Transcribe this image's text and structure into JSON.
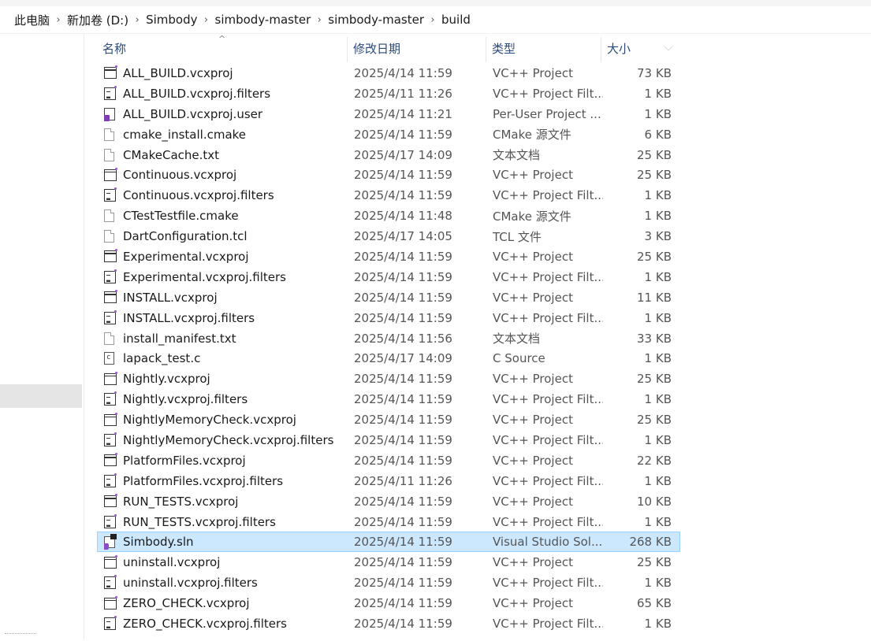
{
  "breadcrumb": [
    "此电脑",
    "新加卷 (D:)",
    "Simbody",
    "simbody-master",
    "simbody-master",
    "build"
  ],
  "columns": {
    "name": "名称",
    "date": "修改日期",
    "type": "类型",
    "size": "大小"
  },
  "files": [
    {
      "name": "ALL_BUILD.vcxproj",
      "date": "2025/4/14 11:59",
      "type": "VC++ Project",
      "size": "73 KB",
      "icon": "vcxproj-icon"
    },
    {
      "name": "ALL_BUILD.vcxproj.filters",
      "date": "2025/4/11 11:26",
      "type": "VC++ Project Filt...",
      "size": "1 KB",
      "icon": "filters-icon"
    },
    {
      "name": "ALL_BUILD.vcxproj.user",
      "date": "2025/4/14 11:21",
      "type": "Per-User Project ...",
      "size": "1 KB",
      "icon": "user-project-icon"
    },
    {
      "name": "cmake_install.cmake",
      "date": "2025/4/14 11:59",
      "type": "CMake 源文件",
      "size": "6 KB",
      "icon": "document-icon"
    },
    {
      "name": "CMakeCache.txt",
      "date": "2025/4/17 14:09",
      "type": "文本文档",
      "size": "25 KB",
      "icon": "document-icon"
    },
    {
      "name": "Continuous.vcxproj",
      "date": "2025/4/14 11:59",
      "type": "VC++ Project",
      "size": "25 KB",
      "icon": "vcxproj-icon"
    },
    {
      "name": "Continuous.vcxproj.filters",
      "date": "2025/4/14 11:59",
      "type": "VC++ Project Filt...",
      "size": "1 KB",
      "icon": "filters-icon"
    },
    {
      "name": "CTestTestfile.cmake",
      "date": "2025/4/14 11:48",
      "type": "CMake 源文件",
      "size": "1 KB",
      "icon": "document-icon"
    },
    {
      "name": "DartConfiguration.tcl",
      "date": "2025/4/17 14:05",
      "type": "TCL 文件",
      "size": "3 KB",
      "icon": "document-icon"
    },
    {
      "name": "Experimental.vcxproj",
      "date": "2025/4/14 11:59",
      "type": "VC++ Project",
      "size": "25 KB",
      "icon": "vcxproj-icon"
    },
    {
      "name": "Experimental.vcxproj.filters",
      "date": "2025/4/14 11:59",
      "type": "VC++ Project Filt...",
      "size": "1 KB",
      "icon": "filters-icon"
    },
    {
      "name": "INSTALL.vcxproj",
      "date": "2025/4/14 11:59",
      "type": "VC++ Project",
      "size": "11 KB",
      "icon": "vcxproj-icon"
    },
    {
      "name": "INSTALL.vcxproj.filters",
      "date": "2025/4/14 11:59",
      "type": "VC++ Project Filt...",
      "size": "1 KB",
      "icon": "filters-icon"
    },
    {
      "name": "install_manifest.txt",
      "date": "2025/4/14 11:56",
      "type": "文本文档",
      "size": "33 KB",
      "icon": "document-icon"
    },
    {
      "name": "lapack_test.c",
      "date": "2025/4/17 14:09",
      "type": "C Source",
      "size": "1 KB",
      "icon": "c-source-icon"
    },
    {
      "name": "Nightly.vcxproj",
      "date": "2025/4/14 11:59",
      "type": "VC++ Project",
      "size": "25 KB",
      "icon": "vcxproj-icon"
    },
    {
      "name": "Nightly.vcxproj.filters",
      "date": "2025/4/14 11:59",
      "type": "VC++ Project Filt...",
      "size": "1 KB",
      "icon": "filters-icon"
    },
    {
      "name": "NightlyMemoryCheck.vcxproj",
      "date": "2025/4/14 11:59",
      "type": "VC++ Project",
      "size": "25 KB",
      "icon": "vcxproj-icon"
    },
    {
      "name": "NightlyMemoryCheck.vcxproj.filters",
      "date": "2025/4/14 11:59",
      "type": "VC++ Project Filt...",
      "size": "1 KB",
      "icon": "filters-icon"
    },
    {
      "name": "PlatformFiles.vcxproj",
      "date": "2025/4/14 11:59",
      "type": "VC++ Project",
      "size": "22 KB",
      "icon": "vcxproj-icon"
    },
    {
      "name": "PlatformFiles.vcxproj.filters",
      "date": "2025/4/11 11:26",
      "type": "VC++ Project Filt...",
      "size": "1 KB",
      "icon": "filters-icon"
    },
    {
      "name": "RUN_TESTS.vcxproj",
      "date": "2025/4/14 11:59",
      "type": "VC++ Project",
      "size": "10 KB",
      "icon": "vcxproj-icon"
    },
    {
      "name": "RUN_TESTS.vcxproj.filters",
      "date": "2025/4/14 11:59",
      "type": "VC++ Project Filt...",
      "size": "1 KB",
      "icon": "filters-icon"
    },
    {
      "name": "Simbody.sln",
      "date": "2025/4/14 11:59",
      "type": "Visual Studio Sol...",
      "size": "268 KB",
      "icon": "solution-icon",
      "selected": true
    },
    {
      "name": "uninstall.vcxproj",
      "date": "2025/4/14 11:59",
      "type": "VC++ Project",
      "size": "25 KB",
      "icon": "vcxproj-icon"
    },
    {
      "name": "uninstall.vcxproj.filters",
      "date": "2025/4/14 11:59",
      "type": "VC++ Project Filt...",
      "size": "1 KB",
      "icon": "filters-icon"
    },
    {
      "name": "ZERO_CHECK.vcxproj",
      "date": "2025/4/14 11:59",
      "type": "VC++ Project",
      "size": "65 KB",
      "icon": "vcxproj-icon"
    },
    {
      "name": "ZERO_CHECK.vcxproj.filters",
      "date": "2025/4/14 11:59",
      "type": "VC++ Project Filt...",
      "size": "1 KB",
      "icon": "filters-icon"
    }
  ],
  "colors": {
    "selection_bg": "#cce8ff",
    "selection_border": "#99d1ff",
    "header_text": "#2b4a7a",
    "secondary_text": "#555555"
  }
}
